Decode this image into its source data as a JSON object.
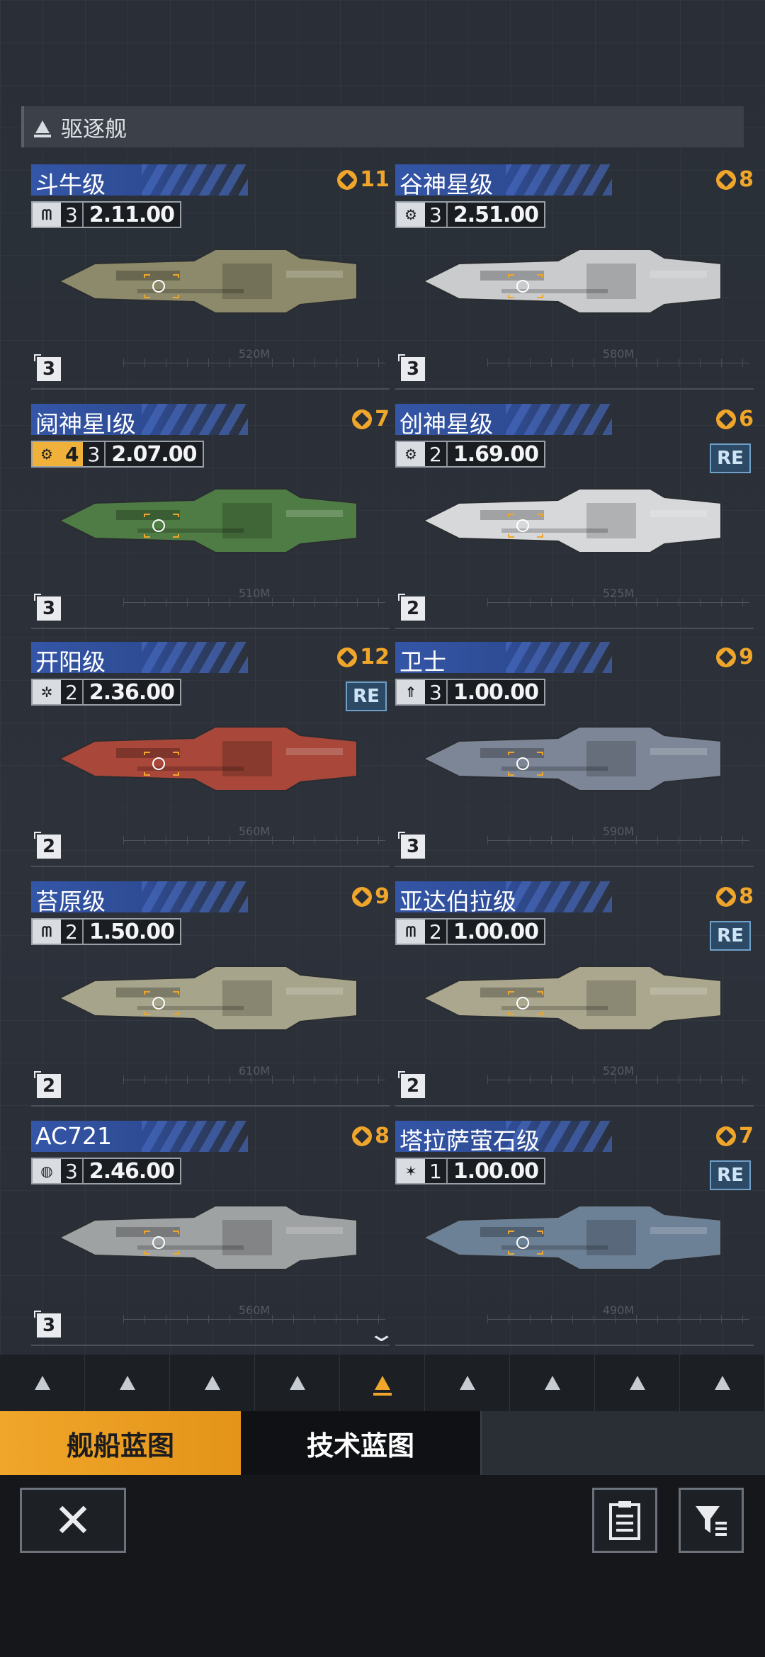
{
  "category": {
    "label": "驱逐舰"
  },
  "ships": [
    {
      "name": "斗牛级",
      "count": "11",
      "tier": "3",
      "cost": "2.11",
      "cost_suffix": ".00",
      "extra": "",
      "re": "",
      "size_tier": "3",
      "length": "520M",
      "color": "#8d8a6b",
      "icon": "corp-icon"
    },
    {
      "name": "谷神星级",
      "count": "8",
      "tier": "3",
      "cost": "2.51",
      "cost_suffix": ".00",
      "extra": "",
      "re": "",
      "size_tier": "3",
      "length": "580M",
      "color": "#c9cbcc",
      "icon": "gear-icon"
    },
    {
      "name": "阋神星I级",
      "count": "7",
      "tier": "3",
      "cost": "2.07",
      "cost_suffix": ".00",
      "extra": "4",
      "re": "",
      "size_tier": "3",
      "length": "510M",
      "color": "#4f7c44",
      "icon": "gear-icon"
    },
    {
      "name": "创神星级",
      "count": "6",
      "tier": "2",
      "cost": "1.69",
      "cost_suffix": ".00",
      "extra": "",
      "re": "RE",
      "size_tier": "2",
      "length": "525M",
      "color": "#d6d8da",
      "icon": "gear-icon"
    },
    {
      "name": "开阳级",
      "count": "12",
      "tier": "2",
      "cost": "2.36",
      "cost_suffix": ".00",
      "extra": "",
      "re": "RE",
      "size_tier": "2",
      "length": "560M",
      "color": "#a8473a",
      "icon": "swirl-icon"
    },
    {
      "name": "卫士",
      "count": "9",
      "tier": "3",
      "cost": "1.00",
      "cost_suffix": ".00",
      "extra": "",
      "re": "",
      "size_tier": "3",
      "length": "590M",
      "color": "#7d8696",
      "icon": "rocket-icon"
    },
    {
      "name": "苔原级",
      "count": "9",
      "tier": "2",
      "cost": "1.50",
      "cost_suffix": ".00",
      "extra": "",
      "re": "",
      "size_tier": "2",
      "length": "610M",
      "color": "#a6a48a",
      "icon": "corp-icon"
    },
    {
      "name": "亚达伯拉级",
      "count": "8",
      "tier": "2",
      "cost": "1.00",
      "cost_suffix": ".00",
      "extra": "",
      "re": "RE",
      "size_tier": "2",
      "length": "520M",
      "color": "#aaa78e",
      "icon": "corp-icon"
    },
    {
      "name": "AC721",
      "count": "8",
      "tier": "3",
      "cost": "2.46",
      "cost_suffix": ".00",
      "extra": "",
      "re": "",
      "size_tier": "3",
      "length": "560M",
      "color": "#9fa2a3",
      "icon": "globe-icon"
    },
    {
      "name": "塔拉萨萤石级",
      "count": "7",
      "tier": "1",
      "cost": "1.00",
      "cost_suffix": ".00",
      "extra": "",
      "re": "RE",
      "size_tier": "",
      "length": "490M",
      "color": "#6d8196",
      "icon": "tri-blade-icon"
    }
  ],
  "class_tabs": [
    "carrier-icon",
    "cruiser-icon",
    "frigate-icon",
    "corvette-icon",
    "destroyer-icon",
    "fighter-icon",
    "support-icon",
    "swarm-icon",
    "station-icon"
  ],
  "active_class_index": 4,
  "mode_tabs": {
    "ship_blueprint": "舰船蓝图",
    "tech_blueprint": "技术蓝图"
  },
  "accent_color": "#f0a62a"
}
